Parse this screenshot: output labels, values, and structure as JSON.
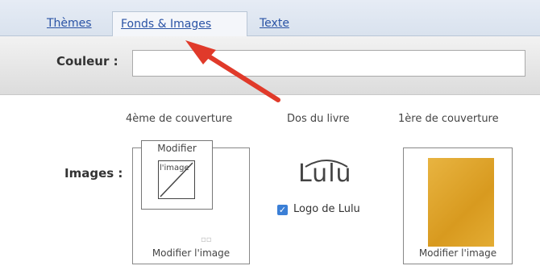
{
  "tabs": [
    {
      "label": "Thèmes"
    },
    {
      "label": "Fonds & Images"
    },
    {
      "label": "Texte"
    }
  ],
  "active_tab": "Fonds & Images",
  "color": {
    "label": "Couleur :",
    "value": ""
  },
  "columns": {
    "back": "4ème de couverture",
    "spine": "Dos du livre",
    "front": "1ère de couverture"
  },
  "images": {
    "label": "Images :",
    "back_popup_title": "Modifier",
    "back_popup_thumb": "l'image",
    "back_modify": "Modifier l'image",
    "spine_logo": "Lulu",
    "logo_checkbox_label": "Logo de Lulu",
    "logo_checked": true,
    "front_modify": "Modifier l'image"
  },
  "colors": {
    "accent_arrow": "#e03a2a",
    "link": "#2a53a5",
    "front_image": "#e0a630"
  }
}
